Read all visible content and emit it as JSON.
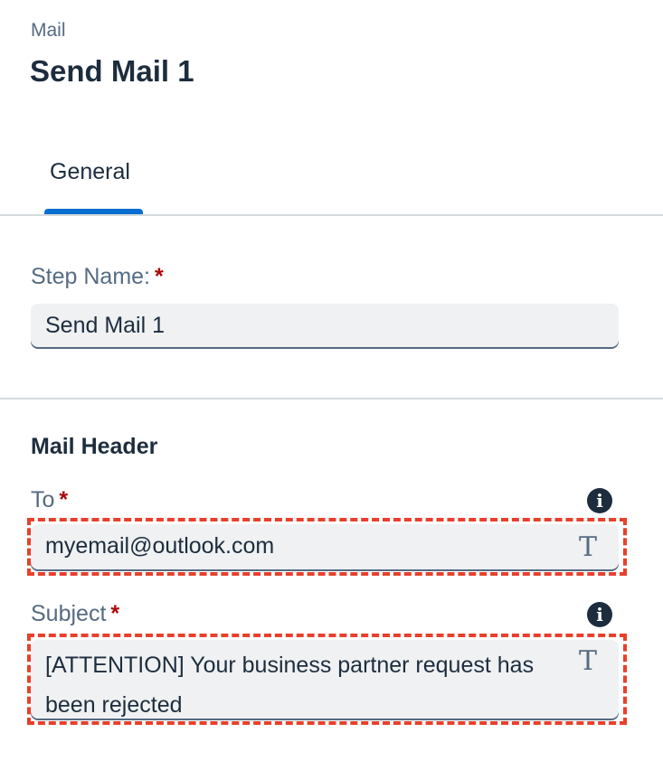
{
  "header": {
    "breadcrumb": "Mail",
    "title": "Send Mail 1"
  },
  "tabs": [
    {
      "label": "General",
      "selected": true
    }
  ],
  "step_name": {
    "label": "Step Name:",
    "required_marker": "*",
    "value": "Send Mail 1"
  },
  "mail_header": {
    "title": "Mail Header",
    "to": {
      "label": "To",
      "required_marker": "*",
      "value": "myemail@outlook.com",
      "info_glyph": "i",
      "type_glyph": "T"
    },
    "subject": {
      "label": "Subject",
      "required_marker": "*",
      "value": "[ATTENTION] Your business partner request has been rejected",
      "info_glyph": "i",
      "type_glyph": "T"
    }
  },
  "colors": {
    "accent": "#0a6ed1",
    "required": "#aa0808",
    "highlight": "#e8402b",
    "field_bg": "#eff1f2"
  },
  "icons": {
    "info": "info-icon",
    "text_type": "text-type-icon"
  }
}
